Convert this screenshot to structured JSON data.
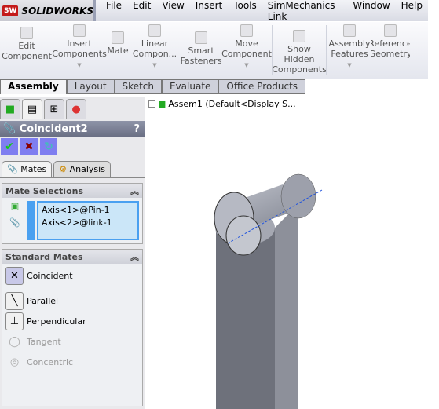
{
  "app": {
    "logo_badge": "SW",
    "logo_text": "SOLIDWORKS"
  },
  "menu": [
    "File",
    "Edit",
    "View",
    "Insert",
    "Tools",
    "SimMechanics Link",
    "Window",
    "Help"
  ],
  "toolbar": [
    {
      "label": "Edit Component",
      "dropdown": false
    },
    {
      "label": "Insert Components",
      "dropdown": true
    },
    {
      "label": "Mate",
      "dropdown": false
    },
    {
      "label": "Linear Compon...",
      "dropdown": true
    },
    {
      "label": "Smart Fasteners",
      "dropdown": false
    },
    {
      "label": "Move Component",
      "dropdown": true
    },
    {
      "label": "Show Hidden Components",
      "dropdown": false
    },
    {
      "label": "Assembly Features",
      "dropdown": true
    },
    {
      "label": "Reference Geometry",
      "dropdown": true
    }
  ],
  "tabs": [
    "Assembly",
    "Layout",
    "Sketch",
    "Evaluate",
    "Office Products"
  ],
  "active_tab": "Assembly",
  "panel": {
    "title": "Coincident2",
    "help": "?",
    "subtabs": [
      "Mates",
      "Analysis"
    ],
    "mate_selections": {
      "header": "Mate Selections",
      "items": [
        "Axis<1>@Pin-1",
        "Axis<2>@link-1"
      ]
    },
    "standard_mates": {
      "header": "Standard Mates",
      "items": [
        {
          "label": "Coincident",
          "state": "selected"
        },
        {
          "label": "Parallel",
          "state": "enabled"
        },
        {
          "label": "Perpendicular",
          "state": "enabled"
        },
        {
          "label": "Tangent",
          "state": "disabled"
        },
        {
          "label": "Concentric",
          "state": "disabled"
        }
      ]
    }
  },
  "tree": {
    "label": "Assem1  (Default<Display S..."
  },
  "colors": {
    "accent": "#7f7ef0",
    "selection": "#cbe6f8",
    "part": "#8f929c"
  }
}
